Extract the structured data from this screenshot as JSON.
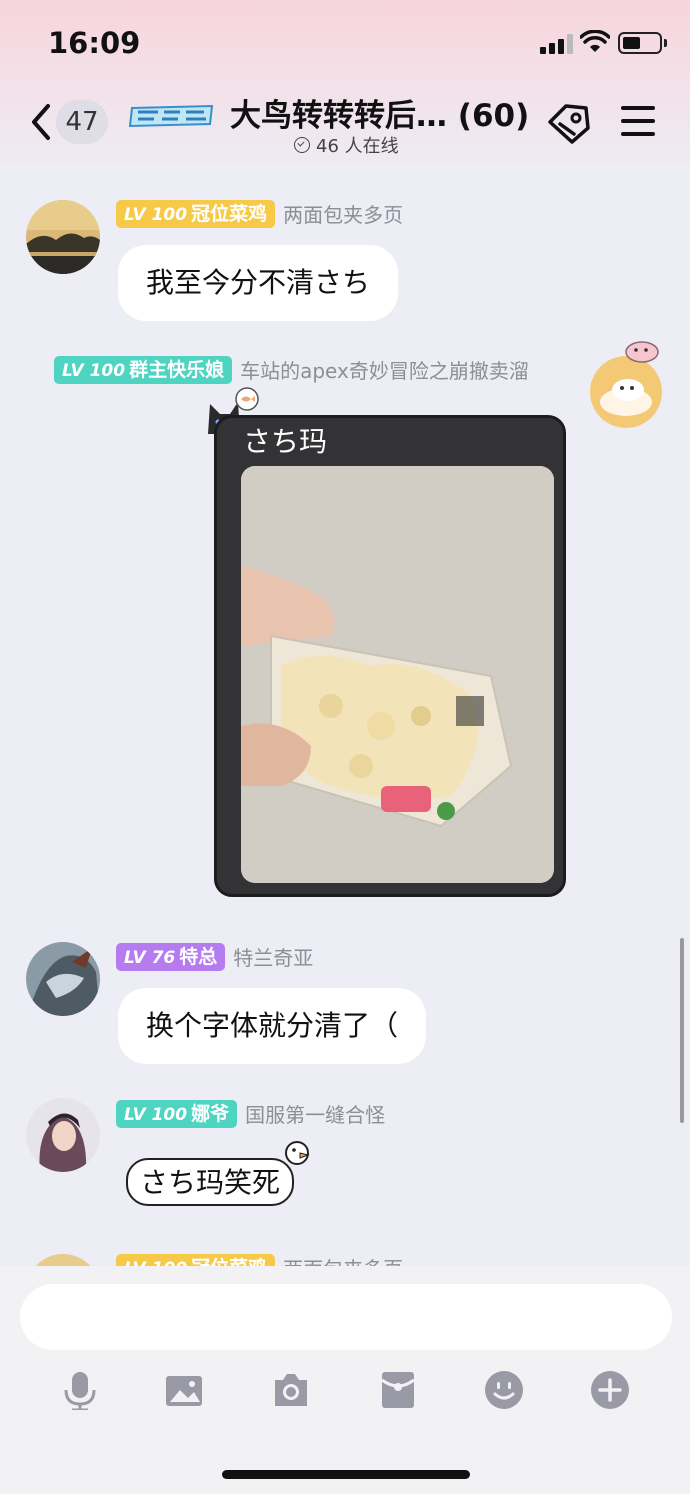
{
  "status": {
    "time": "16:09"
  },
  "header": {
    "back_count": "47",
    "title": "大鸟转转转后… (60)",
    "online": "46 人在线"
  },
  "messages": [
    {
      "level": "LV 100",
      "title": "冠位菜鸡",
      "nickname": "两面包夹多页",
      "text": "我至今分不清さち",
      "badge_color": "#f7c948"
    },
    {
      "level": "LV 100",
      "title": "群主快乐娘",
      "nickname": "车站的apex奇妙冒险之崩撤卖溜",
      "text": "さち玛",
      "badge_color": "#4fd4c2"
    },
    {
      "level": "LV 76",
      "title": "特总",
      "nickname": "特兰奇亚",
      "text": "换个字体就分清了（",
      "badge_color": "#b57cf0"
    },
    {
      "level": "LV 100",
      "title": "娜爷",
      "nickname": "国服第一缝合怪",
      "text": "さち玛笑死",
      "badge_color": "#4fd4c2"
    },
    {
      "level": "LV 100",
      "title": "冠位菜鸡",
      "nickname": "两面包夹多页",
      "badge_color": "#f7c948"
    }
  ],
  "toolbar": {
    "icons": [
      "microphone-icon",
      "image-icon",
      "camera-icon",
      "red-packet-icon",
      "emoji-icon",
      "plus-icon"
    ]
  }
}
